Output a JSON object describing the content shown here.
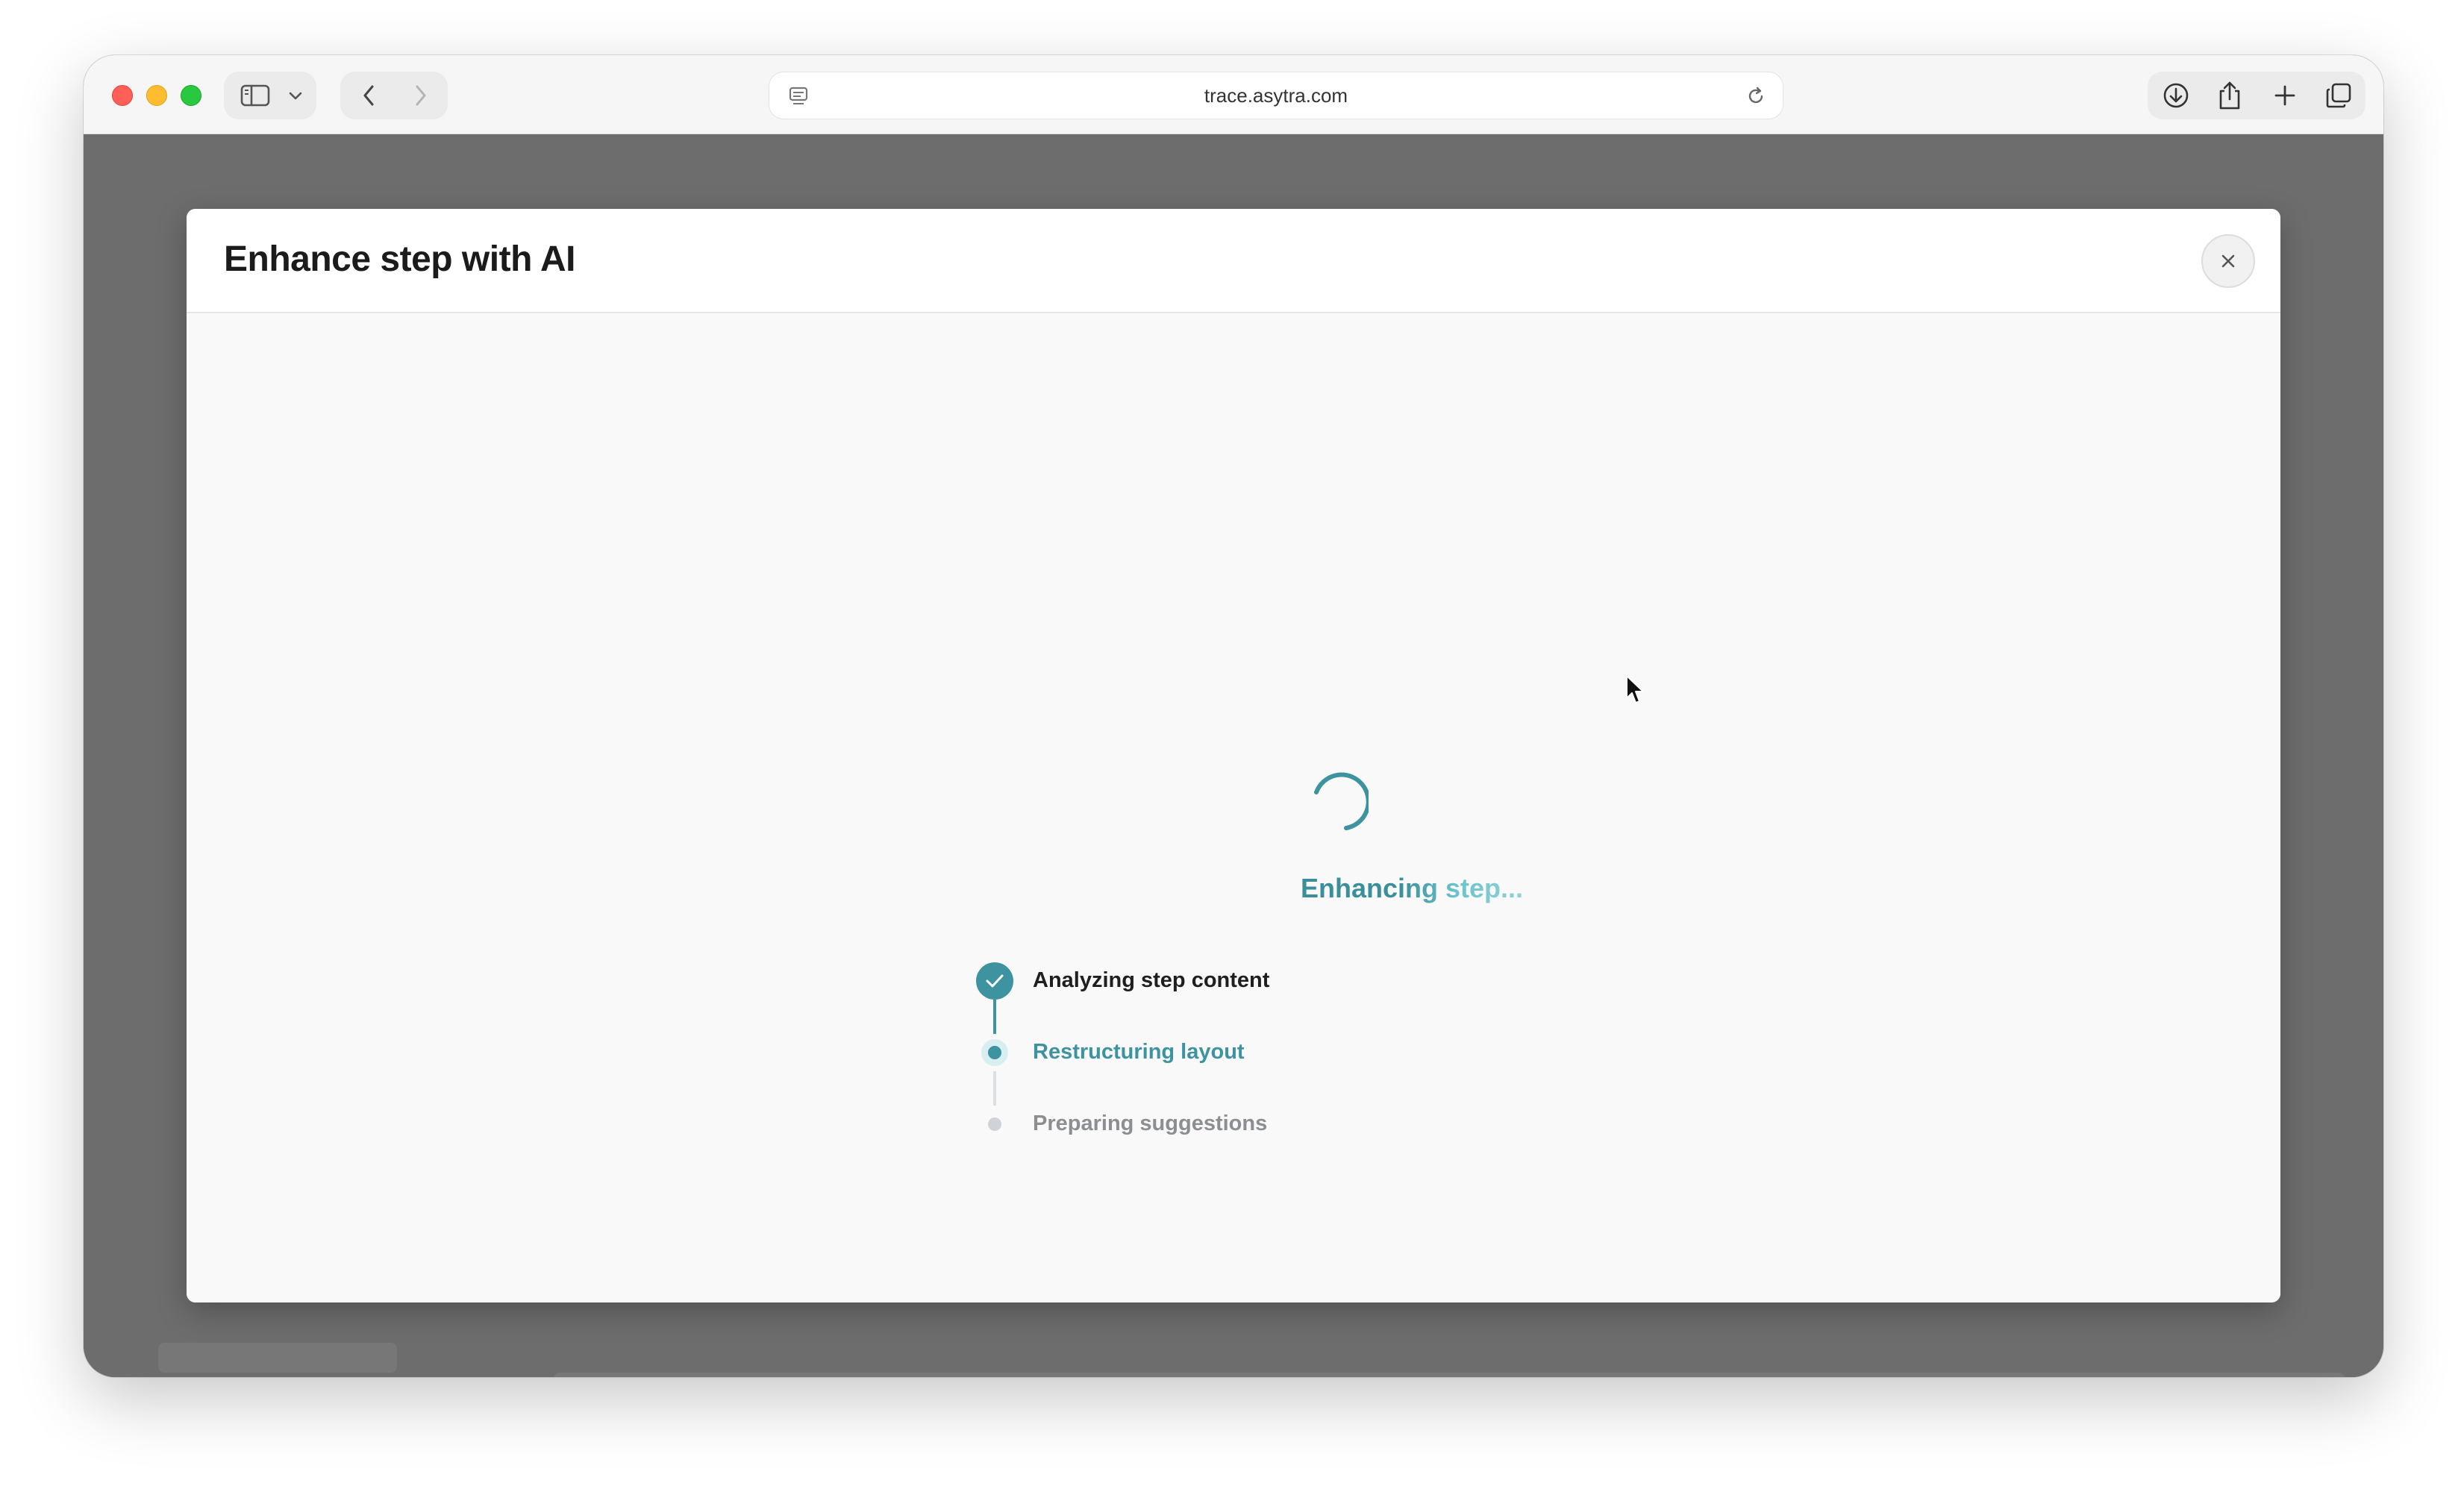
{
  "browser": {
    "url": "trace.asytra.com",
    "icons": [
      "sidebar-icon",
      "chevron-down-icon",
      "back-icon",
      "forward-icon",
      "reader-icon",
      "reload-icon",
      "download-icon",
      "share-icon",
      "new-tab-icon",
      "tab-overview-icon"
    ]
  },
  "modal": {
    "title": "Enhance step with AI",
    "status": "Enhancing step...",
    "steps": [
      {
        "label": "Analyzing step content",
        "state": "done"
      },
      {
        "label": "Restructuring layout",
        "state": "active"
      },
      {
        "label": "Preparing suggestions",
        "state": "pending"
      }
    ]
  },
  "colors": {
    "accent": "#3e93a0",
    "accent_light": "#d8eef0",
    "pending": "#cfd3d7"
  }
}
